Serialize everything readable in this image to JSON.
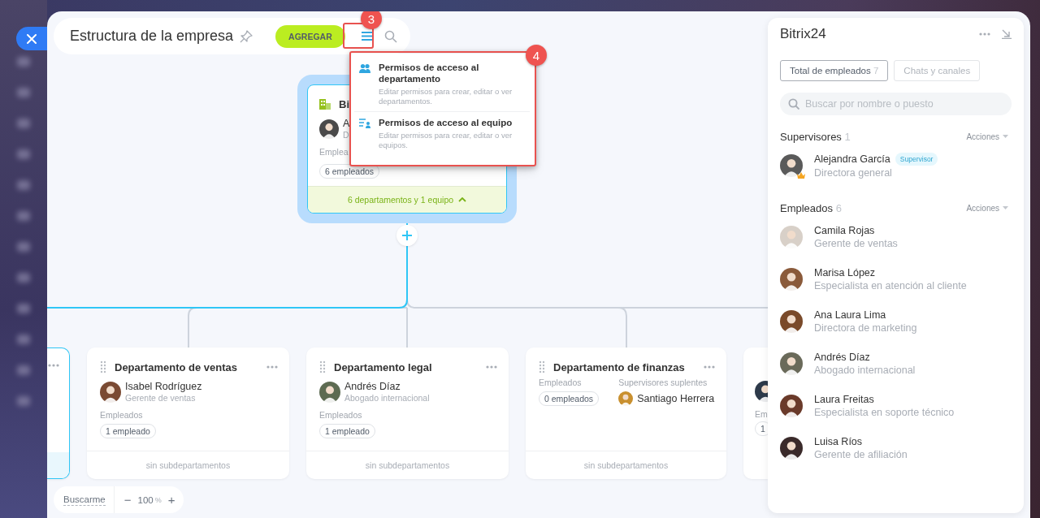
{
  "header": {
    "title": "Estructura de la empresa",
    "add_button": "AGREGAR"
  },
  "callouts": [
    {
      "number": "3"
    },
    {
      "number": "4"
    }
  ],
  "menu": {
    "items": [
      {
        "kind": "department",
        "title": "Permisos de acceso al departamento",
        "description": "Editar permisos para crear, editar o ver departamentos."
      },
      {
        "kind": "team",
        "title": "Permisos de acceso al equipo",
        "description": "Editar permisos para crear, editar o ver equipos."
      }
    ]
  },
  "root_card": {
    "title": "Bi",
    "person_name": "A",
    "person_role": "D",
    "employees_label": "Emplea",
    "employees_count": "6 empleados",
    "footer": "6 departamentos y 1 equipo",
    "expanded": true
  },
  "departments": [
    {
      "kind": "edge",
      "highlighted": true
    },
    {
      "kind": "full",
      "highlighted": false,
      "title": "Departamento de ventas",
      "person_name": "Isabel Rodríguez",
      "person_role": "Gerente de ventas",
      "employees_label": "Empleados",
      "employees_count": "1 empleado",
      "footer": "sin subdepartamentos"
    },
    {
      "kind": "full",
      "highlighted": false,
      "title": "Departamento legal",
      "person_name": "Andrés Díaz",
      "person_role": "Abogado internacional",
      "employees_label": "Empleados",
      "employees_count": "1 empleado",
      "footer": "sin subdepartamentos"
    },
    {
      "kind": "deputy",
      "highlighted": false,
      "title": "Departamento de finanzas",
      "employees_label": "Empleados",
      "employees_count": "0 empleados",
      "deputy_label": "Supervisores suplentes",
      "deputy_name": "Santiago Herrera",
      "footer": "sin subdepartamentos"
    },
    {
      "kind": "cut",
      "highlighted": false,
      "employees_label": "Em",
      "employees_count": "1"
    }
  ],
  "zoom": {
    "find_me": "Buscarme",
    "zoom_out": "−",
    "level": "100",
    "unit": "%",
    "zoom_in": "+"
  },
  "panel": {
    "title": "Bitrix24",
    "tabs": [
      {
        "label": "Total de empleados",
        "count": "7",
        "selected": true
      },
      {
        "label": "Chats y canales",
        "selected": false
      }
    ],
    "search": {
      "placeholder": "Buscar por nombre o puesto"
    },
    "sections": [
      {
        "title": "Supervisores",
        "count": "1",
        "actions": "Acciones",
        "people": [
          {
            "name": "Alejandra García",
            "role": "Directora general",
            "badge": "Supervisor",
            "head": true
          }
        ]
      },
      {
        "title": "Empleados",
        "count": "6",
        "actions": "Acciones",
        "people": [
          {
            "name": "Camila Rojas",
            "role": "Gerente de ventas",
            "head": false
          },
          {
            "name": "Marisa López",
            "role": "Especialista en atención al cliente",
            "head": false
          },
          {
            "name": "Ana Laura Lima",
            "role": "Directora de marketing",
            "head": false
          },
          {
            "name": "Andrés Díaz",
            "role": "Abogado internacional",
            "head": false
          },
          {
            "name": "Laura Freitas",
            "role": "Especialista en soporte técnico",
            "head": false
          },
          {
            "name": "Luisa Ríos",
            "role": "Gerente de afiliación",
            "head": false
          }
        ]
      }
    ]
  }
}
